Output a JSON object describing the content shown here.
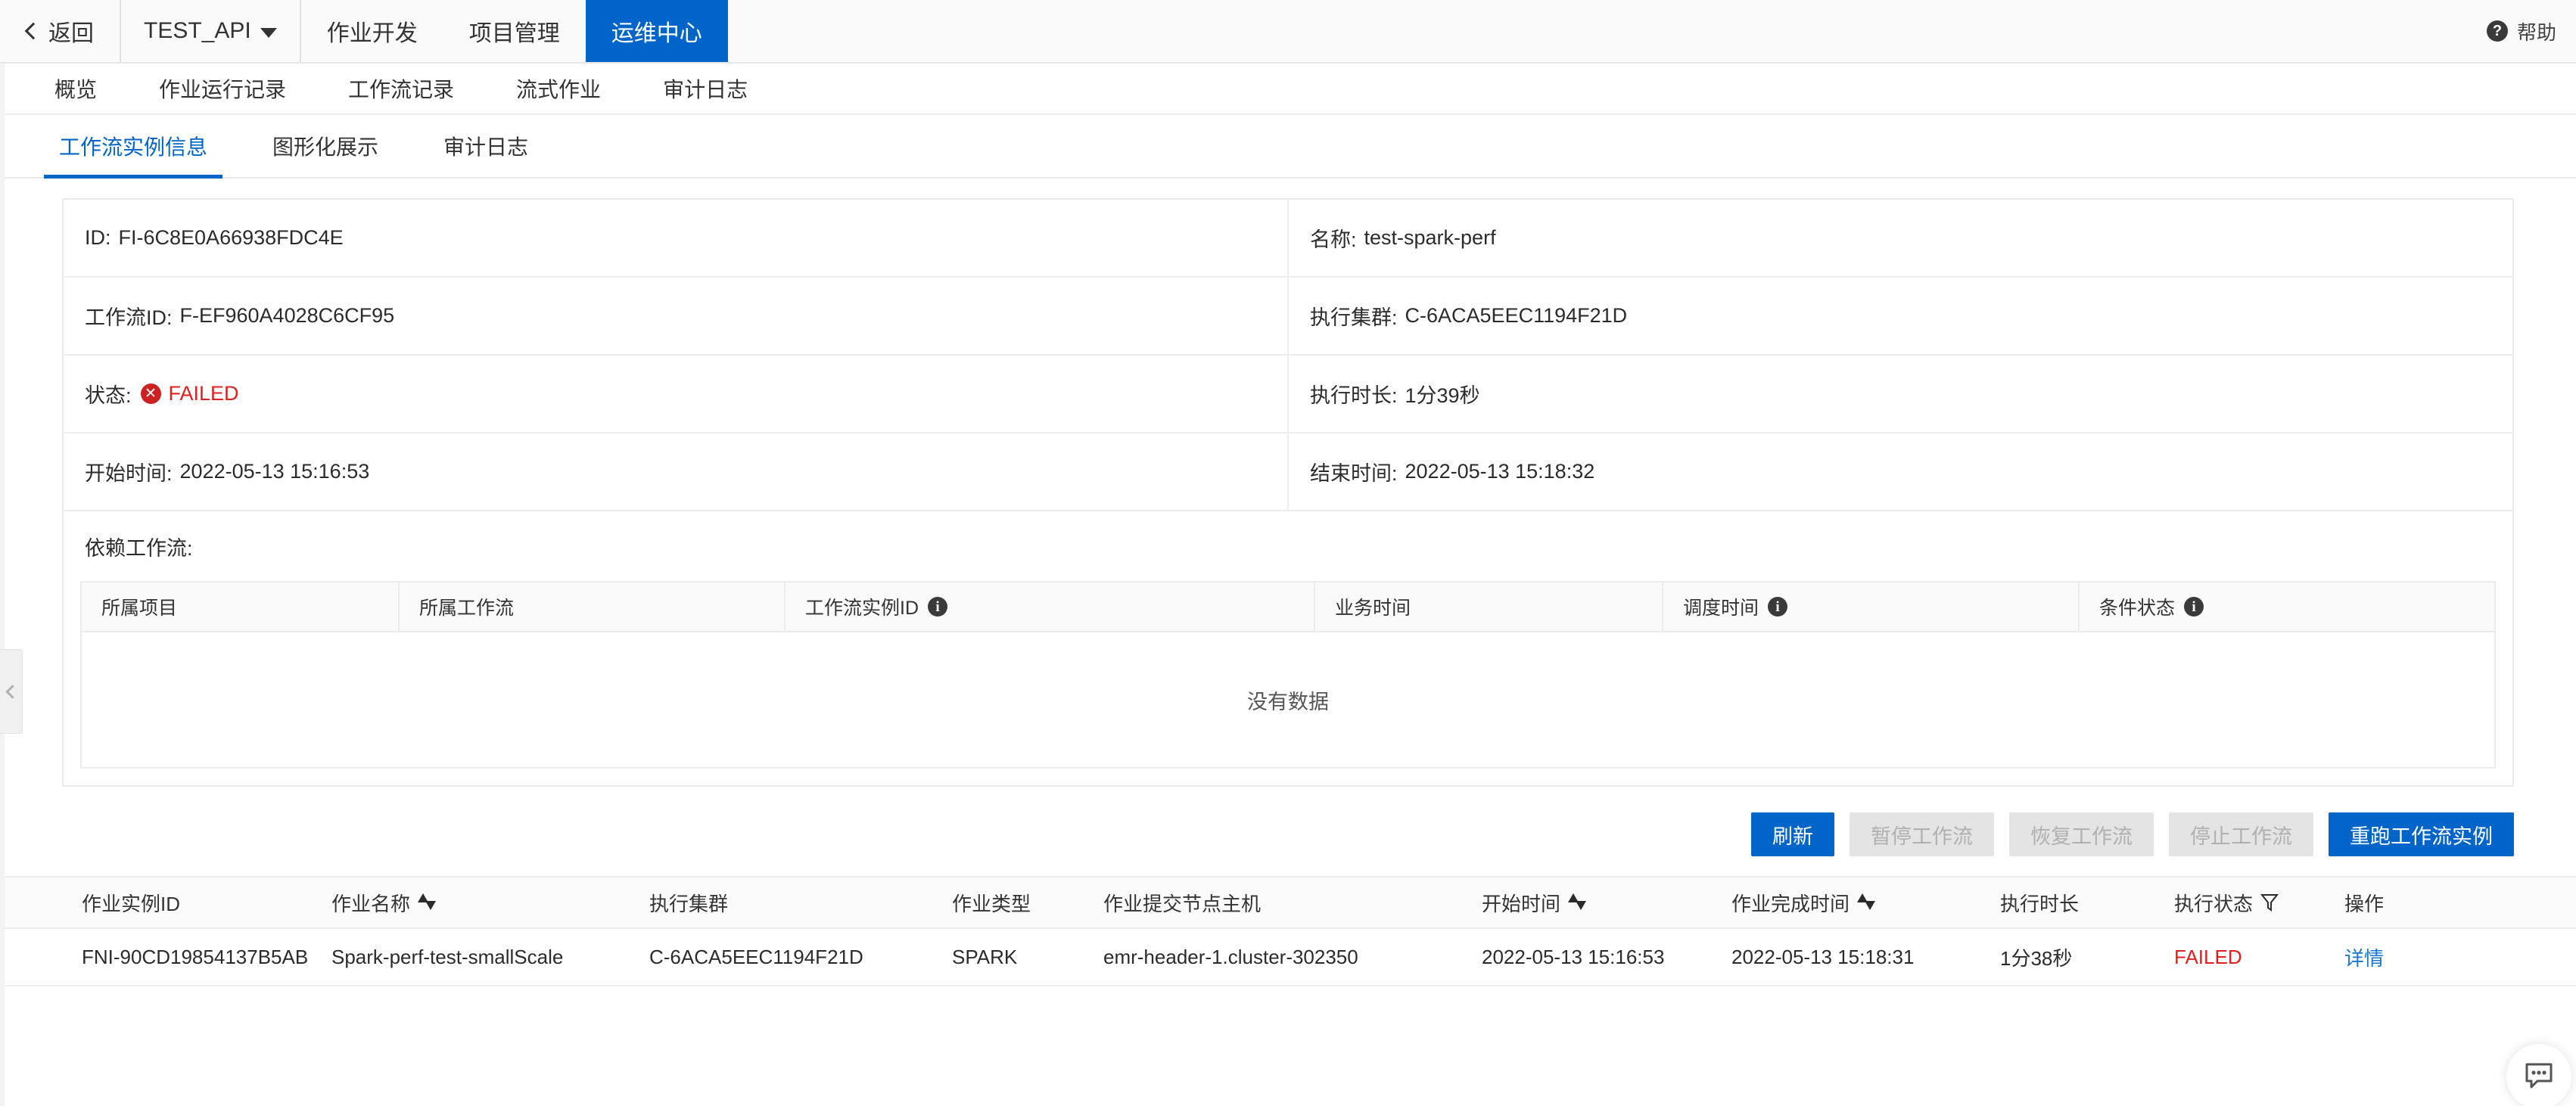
{
  "topnav": {
    "back_label": "返回",
    "back_icon": "chevron-left-icon",
    "project_label": "TEST_API",
    "project_caret": "chevron-down-icon",
    "items": [
      {
        "label": "作业开发",
        "active": false
      },
      {
        "label": "项目管理",
        "active": false
      },
      {
        "label": "运维中心",
        "active": true
      }
    ],
    "help_label": "帮助",
    "help_icon": "question-circle-icon"
  },
  "subnav": {
    "items": [
      {
        "label": "概览",
        "active": false
      },
      {
        "label": "作业运行记录",
        "active": false
      },
      {
        "label": "工作流记录",
        "active": false
      },
      {
        "label": "流式作业",
        "active": false
      },
      {
        "label": "审计日志",
        "active": false
      }
    ]
  },
  "tabs": [
    {
      "label": "工作流实例信息",
      "active": true
    },
    {
      "label": "图形化展示",
      "active": false
    },
    {
      "label": "审计日志",
      "active": false
    }
  ],
  "instance_info": {
    "rows": [
      {
        "left": {
          "label": "ID:",
          "value": "FI-6C8E0A66938FDC4E"
        },
        "right": {
          "label": "名称:",
          "value": "test-spark-perf"
        }
      },
      {
        "left": {
          "label": "工作流ID:",
          "value": "F-EF960A4028C6CF95"
        },
        "right": {
          "label": "执行集群:",
          "value": "C-6ACA5EEC1194F21D"
        }
      },
      {
        "left": {
          "label": "状态:",
          "value": "FAILED",
          "status": true,
          "status_icon": "error-circle-icon",
          "status_color": "#e02020"
        },
        "right": {
          "label": "执行时长:",
          "value": "1分39秒"
        }
      },
      {
        "left": {
          "label": "开始时间:",
          "value": "2022-05-13 15:16:53"
        },
        "right": {
          "label": "结束时间:",
          "value": "2022-05-13 15:18:32"
        }
      }
    ],
    "dependency_label": "依赖工作流:"
  },
  "dependency_table": {
    "columns": [
      {
        "label": "所属项目",
        "info": false
      },
      {
        "label": "所属工作流",
        "info": false
      },
      {
        "label": "工作流实例ID",
        "info": true,
        "info_icon": "info-circle-icon"
      },
      {
        "label": "业务时间",
        "info": false
      },
      {
        "label": "调度时间",
        "info": true,
        "info_icon": "info-circle-icon"
      },
      {
        "label": "条件状态",
        "info": true,
        "info_icon": "info-circle-icon"
      }
    ],
    "empty_text": "没有数据"
  },
  "actions": [
    {
      "label": "刷新",
      "style": "primary"
    },
    {
      "label": "暂停工作流",
      "style": "disabled"
    },
    {
      "label": "恢复工作流",
      "style": "disabled"
    },
    {
      "label": "停止工作流",
      "style": "disabled"
    },
    {
      "label": "重跑工作流实例",
      "style": "primary"
    }
  ],
  "job_table": {
    "columns": [
      {
        "label": "作业实例ID",
        "icon": ""
      },
      {
        "label": "作业名称",
        "icon": "sort-icon"
      },
      {
        "label": "执行集群",
        "icon": ""
      },
      {
        "label": "作业类型",
        "icon": ""
      },
      {
        "label": "作业提交节点主机",
        "icon": ""
      },
      {
        "label": "开始时间",
        "icon": "sort-icon"
      },
      {
        "label": "作业完成时间",
        "icon": "sort-icon"
      },
      {
        "label": "执行时长",
        "icon": ""
      },
      {
        "label": "执行状态",
        "icon": "filter-icon"
      },
      {
        "label": "操作",
        "icon": ""
      }
    ],
    "rows": [
      {
        "instance_id": "FNI-90CD19854137B5AB",
        "job_name": "Spark-perf-test-smallScale",
        "cluster": "C-6ACA5EEC1194F21D",
        "job_type": "SPARK",
        "submit_host": "emr-header-1.cluster-302350",
        "start_time": "2022-05-13 15:16:53",
        "finish_time": "2022-05-13 15:18:31",
        "duration": "1分38秒",
        "status": "FAILED",
        "action": "详情"
      }
    ]
  },
  "chrome": {
    "collapse_icon": "chevron-left-icon",
    "feedback_icon": "chat-bubble-icon"
  },
  "colors": {
    "accent": "#0064c8",
    "danger": "#e02020",
    "link": "#1677cc"
  }
}
